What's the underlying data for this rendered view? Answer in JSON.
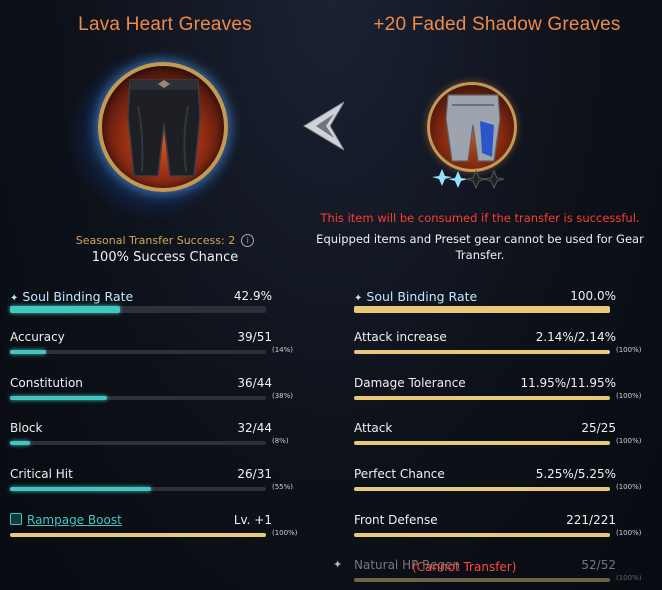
{
  "left": {
    "title": "Lava Heart Greaves",
    "seasonal_transfer": "Seasonal Transfer Success: 2",
    "info_icon": "info-icon",
    "success_chance": "100% Success Chance",
    "soul_binding": {
      "label": "Soul Binding Rate",
      "value": "42.9%",
      "fill": 0.429
    },
    "stats": [
      {
        "label": "Accuracy",
        "value": "39/51",
        "pct": "(14%)",
        "fill": 0.14
      },
      {
        "label": "Constitution",
        "value": "36/44",
        "pct": "(38%)",
        "fill": 0.38
      },
      {
        "label": "Block",
        "value": "32/44",
        "pct": "(8%)",
        "fill": 0.08
      },
      {
        "label": "Critical Hit",
        "value": "26/31",
        "pct": "(55%)",
        "fill": 0.55
      }
    ],
    "rampage": {
      "label": "Rampage Boost",
      "value": "Lv. +1",
      "pct": "(100%)",
      "fill": 1.0
    }
  },
  "right": {
    "title": "+20 Faded Shadow Greaves",
    "warning": "This item will be consumed if the transfer is successful.",
    "note": "Equipped items and Preset gear cannot be used for Gear Transfer.",
    "soul_binding": {
      "label": "Soul Binding Rate",
      "value": "100.0%",
      "fill": 1.0
    },
    "stats": [
      {
        "label": "Attack increase",
        "value": "2.14%/2.14%",
        "pct": "(100%)",
        "fill": 1.0
      },
      {
        "label": "Damage Tolerance",
        "value": "11.95%/11.95%",
        "pct": "(100%)",
        "fill": 1.0
      },
      {
        "label": "Attack",
        "value": "25/25",
        "pct": "(100%)",
        "fill": 1.0
      },
      {
        "label": "Perfect Chance",
        "value": "5.25%/5.25%",
        "pct": "(100%)",
        "fill": 1.0
      },
      {
        "label": "Front Defense",
        "value": "221/221",
        "pct": "(100%)",
        "fill": 1.0
      }
    ],
    "dimmed": {
      "label": "Natural HP Regen",
      "value": "52/52",
      "pct": "(100%)",
      "fill": 1.0
    },
    "cannot_transfer": "(Cannot Transfer)"
  },
  "colors": {
    "title": "#ee8a4a",
    "teal": "#43c6c0",
    "gold": "#e8c97a",
    "warning": "#ff3b30"
  }
}
